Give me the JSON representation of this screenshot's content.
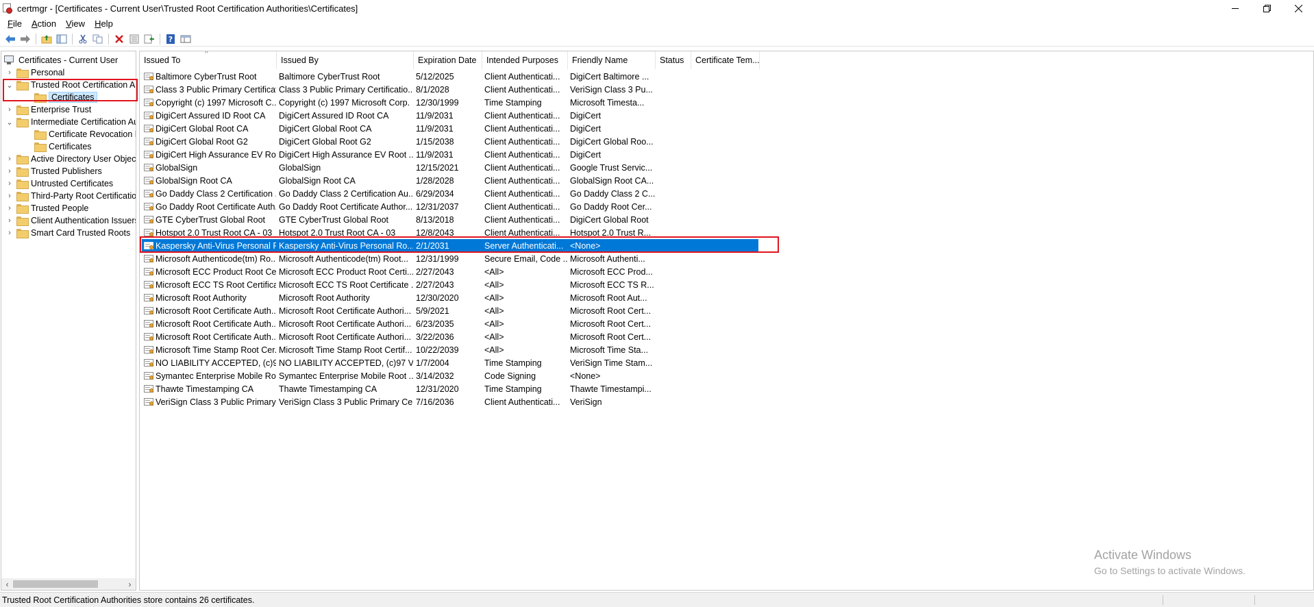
{
  "window": {
    "title": "certmgr - [Certificates - Current User\\Trusted Root Certification Authorities\\Certificates]",
    "minimize_glyph": "—",
    "restore_glyph": "❐",
    "close_glyph": "✕"
  },
  "menu": [
    {
      "accel": "F",
      "rest": "ile"
    },
    {
      "accel": "A",
      "rest": "ction"
    },
    {
      "accel": "V",
      "rest": "iew"
    },
    {
      "accel": "H",
      "rest": "elp"
    }
  ],
  "toolbar": {
    "icons": [
      "back-arrow-icon",
      "forward-arrow-icon",
      "up-folder-icon",
      "show-hide-tree-icon",
      "cut-icon",
      "copy-icon",
      "delete-icon",
      "properties-icon",
      "export-list-icon",
      "help-icon",
      "view-icon"
    ]
  },
  "tree": {
    "root_label": "Certificates - Current User",
    "items": [
      {
        "label": "Personal",
        "expander": "›",
        "level": 1
      },
      {
        "label": "Trusted Root Certification Aut",
        "expander": "⌄",
        "level": 1
      },
      {
        "label": "Certificates",
        "expander": "",
        "level": 2
      },
      {
        "label": "Enterprise Trust",
        "expander": "›",
        "level": 1
      },
      {
        "label": "Intermediate Certification Au",
        "expander": "⌄",
        "level": 1
      },
      {
        "label": "Certificate Revocation List",
        "expander": "",
        "level": 2
      },
      {
        "label": "Certificates",
        "expander": "",
        "level": 2
      },
      {
        "label": "Active Directory User Object",
        "expander": "›",
        "level": 1
      },
      {
        "label": "Trusted Publishers",
        "expander": "›",
        "level": 1
      },
      {
        "label": "Untrusted Certificates",
        "expander": "›",
        "level": 1
      },
      {
        "label": "Third-Party Root Certification",
        "expander": "›",
        "level": 1
      },
      {
        "label": "Trusted People",
        "expander": "›",
        "level": 1
      },
      {
        "label": "Client Authentication Issuers",
        "expander": "›",
        "level": 1
      },
      {
        "label": "Smart Card Trusted Roots",
        "expander": "›",
        "level": 1
      }
    ]
  },
  "list": {
    "sort_glyph": "^",
    "columns": [
      "Issued To",
      "Issued By",
      "Expiration Date",
      "Intended Purposes",
      "Friendly Name",
      "Status",
      "Certificate Tem..."
    ],
    "rows": [
      [
        "Baltimore CyberTrust Root",
        "Baltimore CyberTrust Root",
        "5/12/2025",
        "Client Authenticati...",
        "DigiCert Baltimore ..."
      ],
      [
        "Class 3 Public Primary Certificat...",
        "Class 3 Public Primary Certificatio...",
        "8/1/2028",
        "Client Authenticati...",
        "VeriSign Class 3 Pu..."
      ],
      [
        "Copyright (c) 1997 Microsoft C...",
        "Copyright (c) 1997 Microsoft Corp.",
        "12/30/1999",
        "Time Stamping",
        "Microsoft Timesta..."
      ],
      [
        "DigiCert Assured ID Root CA",
        "DigiCert Assured ID Root CA",
        "11/9/2031",
        "Client Authenticati...",
        "DigiCert"
      ],
      [
        "DigiCert Global Root CA",
        "DigiCert Global Root CA",
        "11/9/2031",
        "Client Authenticati...",
        "DigiCert"
      ],
      [
        "DigiCert Global Root G2",
        "DigiCert Global Root G2",
        "1/15/2038",
        "Client Authenticati...",
        "DigiCert Global Roo..."
      ],
      [
        "DigiCert High Assurance EV Ro...",
        "DigiCert High Assurance EV Root ...",
        "11/9/2031",
        "Client Authenticati...",
        "DigiCert"
      ],
      [
        "GlobalSign",
        "GlobalSign",
        "12/15/2021",
        "Client Authenticati...",
        "Google Trust Servic..."
      ],
      [
        "GlobalSign Root CA",
        "GlobalSign Root CA",
        "1/28/2028",
        "Client Authenticati...",
        "GlobalSign Root CA..."
      ],
      [
        "Go Daddy Class 2 Certification ...",
        "Go Daddy Class 2 Certification Au...",
        "6/29/2034",
        "Client Authenticati...",
        "Go Daddy Class 2 C..."
      ],
      [
        "Go Daddy Root Certificate Auth...",
        "Go Daddy Root Certificate Author...",
        "12/31/2037",
        "Client Authenticati...",
        "Go Daddy Root Cer..."
      ],
      [
        "GTE CyberTrust Global Root",
        "GTE CyberTrust Global Root",
        "8/13/2018",
        "Client Authenticati...",
        "DigiCert Global Root"
      ],
      [
        "Hotspot 2.0 Trust Root CA - 03",
        "Hotspot 2.0 Trust Root CA - 03",
        "12/8/2043",
        "Client Authenticati...",
        "Hotspot 2.0 Trust R..."
      ],
      [
        "Kaspersky Anti-Virus Personal R...",
        "Kaspersky Anti-Virus Personal Ro...",
        "2/1/2031",
        "Server Authenticati...",
        "<None>"
      ],
      [
        "Microsoft Authenticode(tm) Ro...",
        "Microsoft Authenticode(tm) Root...",
        "12/31/1999",
        "Secure Email, Code ...",
        "Microsoft Authenti..."
      ],
      [
        "Microsoft ECC Product Root Ce...",
        "Microsoft ECC Product Root Certi...",
        "2/27/2043",
        "<All>",
        "Microsoft ECC Prod..."
      ],
      [
        "Microsoft ECC TS Root Certifica...",
        "Microsoft ECC TS Root Certificate ...",
        "2/27/2043",
        "<All>",
        "Microsoft ECC TS R..."
      ],
      [
        "Microsoft Root Authority",
        "Microsoft Root Authority",
        "12/30/2020",
        "<All>",
        "Microsoft Root Aut..."
      ],
      [
        "Microsoft Root Certificate Auth...",
        "Microsoft Root Certificate Authori...",
        "5/9/2021",
        "<All>",
        "Microsoft Root Cert..."
      ],
      [
        "Microsoft Root Certificate Auth...",
        "Microsoft Root Certificate Authori...",
        "6/23/2035",
        "<All>",
        "Microsoft Root Cert..."
      ],
      [
        "Microsoft Root Certificate Auth...",
        "Microsoft Root Certificate Authori...",
        "3/22/2036",
        "<All>",
        "Microsoft Root Cert..."
      ],
      [
        "Microsoft Time Stamp Root Cer...",
        "Microsoft Time Stamp Root Certif...",
        "10/22/2039",
        "<All>",
        "Microsoft Time Sta..."
      ],
      [
        "NO LIABILITY ACCEPTED, (c)97 ...",
        "NO LIABILITY ACCEPTED, (c)97 Ve...",
        "1/7/2004",
        "Time Stamping",
        "VeriSign Time Stam..."
      ],
      [
        "Symantec Enterprise Mobile Ro...",
        "Symantec Enterprise Mobile Root ...",
        "3/14/2032",
        "Code Signing",
        "<None>"
      ],
      [
        "Thawte Timestamping CA",
        "Thawte Timestamping CA",
        "12/31/2020",
        "Time Stamping",
        "Thawte Timestampi..."
      ],
      [
        "VeriSign Class 3 Public Primary ...",
        "VeriSign Class 3 Public Primary Ce...",
        "7/16/2036",
        "Client Authenticati...",
        "VeriSign"
      ]
    ],
    "selected_row": 13
  },
  "watermark": {
    "line1": "Activate Windows",
    "line2": "Go to Settings to activate Windows."
  },
  "status": {
    "text": "Trusted Root Certification Authorities store contains 26 certificates."
  },
  "colors": {
    "selection": "#0078d7",
    "highlight_box": "#e0141e"
  }
}
